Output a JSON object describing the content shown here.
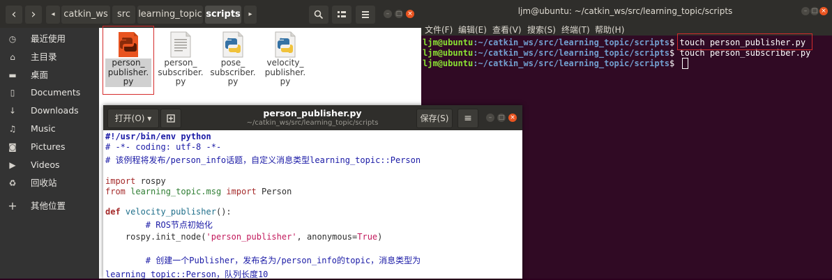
{
  "terminal": {
    "title": "ljm@ubuntu: ~/catkin_ws/src/learning_topic/scripts",
    "menu": [
      "文件(F)",
      "编辑(E)",
      "查看(V)",
      "搜索(S)",
      "终端(T)",
      "帮助(H)"
    ],
    "prompt_user": "ljm@ubuntu",
    "prompt_path": ":~/catkin_ws/src/learning_topic/scripts",
    "prompt_dollar": "$",
    "lines": [
      {
        "command": " touch person_publisher.py"
      },
      {
        "command": " touch person_subscriber.py"
      },
      {
        "command": " "
      }
    ],
    "window_buttons": [
      "–",
      "□",
      "×"
    ]
  },
  "file_manager": {
    "nav_back": "‹",
    "nav_forward": "›",
    "nav_left_arrow": "◂",
    "nav_right_arrow": "▸",
    "breadcrumbs": [
      "catkin_ws",
      "src",
      "learning_topic",
      "scripts"
    ],
    "sidebar": [
      {
        "label": "最近使用",
        "icon": "clock-icon",
        "glyph": "◷"
      },
      {
        "label": "主目录",
        "icon": "home-icon",
        "glyph": "⌂"
      },
      {
        "label": "桌面",
        "icon": "desktop-icon",
        "glyph": "▬"
      },
      {
        "label": "Documents",
        "icon": "document-icon",
        "glyph": "▯"
      },
      {
        "label": "Downloads",
        "icon": "download-icon",
        "glyph": "↓"
      },
      {
        "label": "Music",
        "icon": "music-icon",
        "glyph": "♫"
      },
      {
        "label": "Pictures",
        "icon": "camera-icon",
        "glyph": "◙"
      },
      {
        "label": "Videos",
        "icon": "video-icon",
        "glyph": "▶"
      },
      {
        "label": "回收站",
        "icon": "trash-icon",
        "glyph": "♻"
      },
      {
        "label": "其他位置",
        "icon": "plus-icon",
        "glyph": "+"
      }
    ],
    "files": [
      {
        "name": "person_\npublisher.\npy",
        "type": "python-orange",
        "selected": true
      },
      {
        "name": "person_\nsubscriber.\npy",
        "type": "text",
        "selected": false
      },
      {
        "name": "pose_\nsubscriber.\npy",
        "type": "python",
        "selected": false
      },
      {
        "name": "velocity_\npublisher.\npy",
        "type": "python",
        "selected": false
      }
    ],
    "accent": "#e95420"
  },
  "editor": {
    "open_label": "打开(O)",
    "open_arrow": "▾",
    "title": "person_publisher.py",
    "subtitle": "~/catkin_ws/src/learning_topic/scripts",
    "save_label": "保存(S)",
    "menu_icon": "≡",
    "code": {
      "l1": "#!/usr/bin/env python",
      "l2": "# -*- coding: utf-8 -*-",
      "l3": "# 该例程将发布/person_info话题，自定义消息类型learning_topic::Person",
      "l4_kw": "import",
      "l4_rest": " rospy",
      "l5_kw1": "from",
      "l5_mod": " learning_topic.msg ",
      "l5_kw2": "import",
      "l5_rest": " Person",
      "l6_kw": "def",
      "l6_fn": " velocity_publisher",
      "l6_rest": "():",
      "l7": "        # ROS节点初始化",
      "l8_a": "    rospy.init_node(",
      "l8_str": "'person_publisher'",
      "l8_b": ", anonymous=",
      "l8_const": "True",
      "l8_c": ")",
      "l9": "        # 创建一个Publisher，发布名为/person_info的topic，消息类型为",
      "l10": "learning_topic::Person，队列长度10"
    }
  },
  "colors": {
    "terminal_bg": "#300a24",
    "prompt_user": "#8ae234",
    "prompt_path": "#729fcf",
    "highlight": "#d52b2b"
  }
}
